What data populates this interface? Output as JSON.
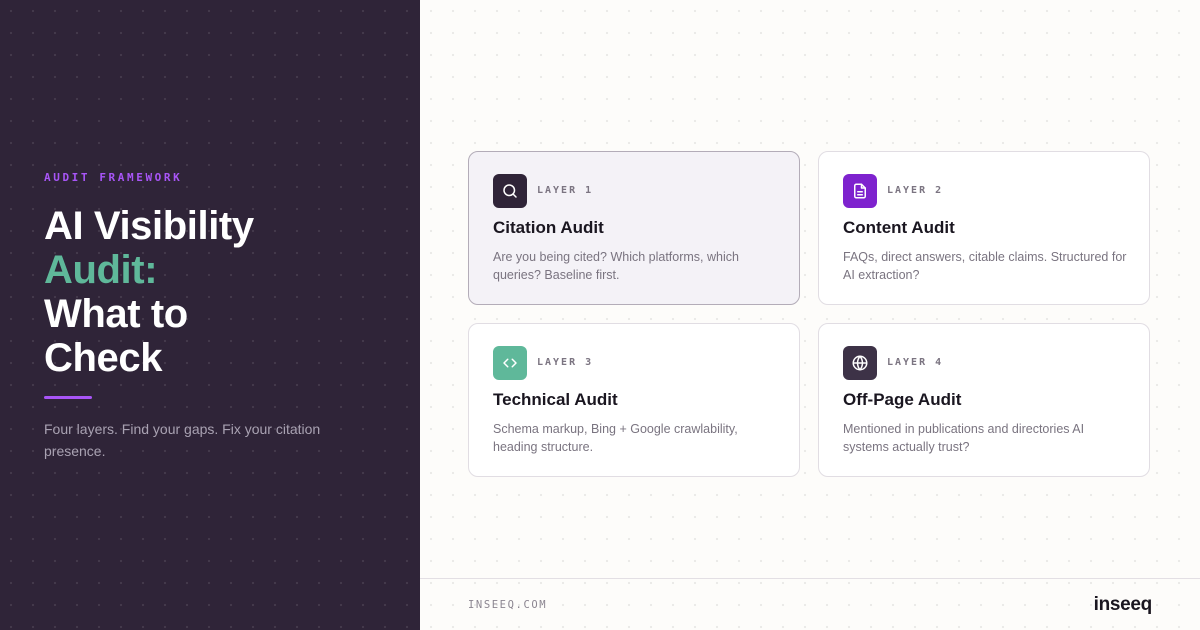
{
  "hero": {
    "eyebrow": "AUDIT FRAMEWORK",
    "title_line1": "AI Visibility",
    "title_line2": "Audit:",
    "title_line3": "What to",
    "title_line4": "Check",
    "subtitle": "Four layers. Find your gaps. Fix your citation presence."
  },
  "cards": [
    {
      "layer": "LAYER 1",
      "title": "Citation Audit",
      "description": "Are you being cited? Which platforms, which queries? Baseline first.",
      "icon": "search-icon",
      "icon_bg": "#2f2438"
    },
    {
      "layer": "LAYER 2",
      "title": "Content Audit",
      "description": "FAQs, direct answers, citable claims. Structured for AI extraction?",
      "icon": "document-icon",
      "icon_bg": "#7e22ce"
    },
    {
      "layer": "LAYER 3",
      "title": "Technical Audit",
      "description": "Schema markup, Bing + Google crawlability, heading structure.",
      "icon": "code-icon",
      "icon_bg": "#5fb89a"
    },
    {
      "layer": "LAYER 4",
      "title": "Off-Page Audit",
      "description": "Mentioned in publications and directories AI systems actually trust?",
      "icon": "globe-icon",
      "icon_bg": "#3d3247"
    }
  ],
  "footer": {
    "url": "INSEEQ.COM",
    "brand": "inseeq"
  },
  "colors": {
    "accent_purple": "#a855f7",
    "accent_green": "#5fb89a",
    "panel_dark": "#2f2438"
  }
}
